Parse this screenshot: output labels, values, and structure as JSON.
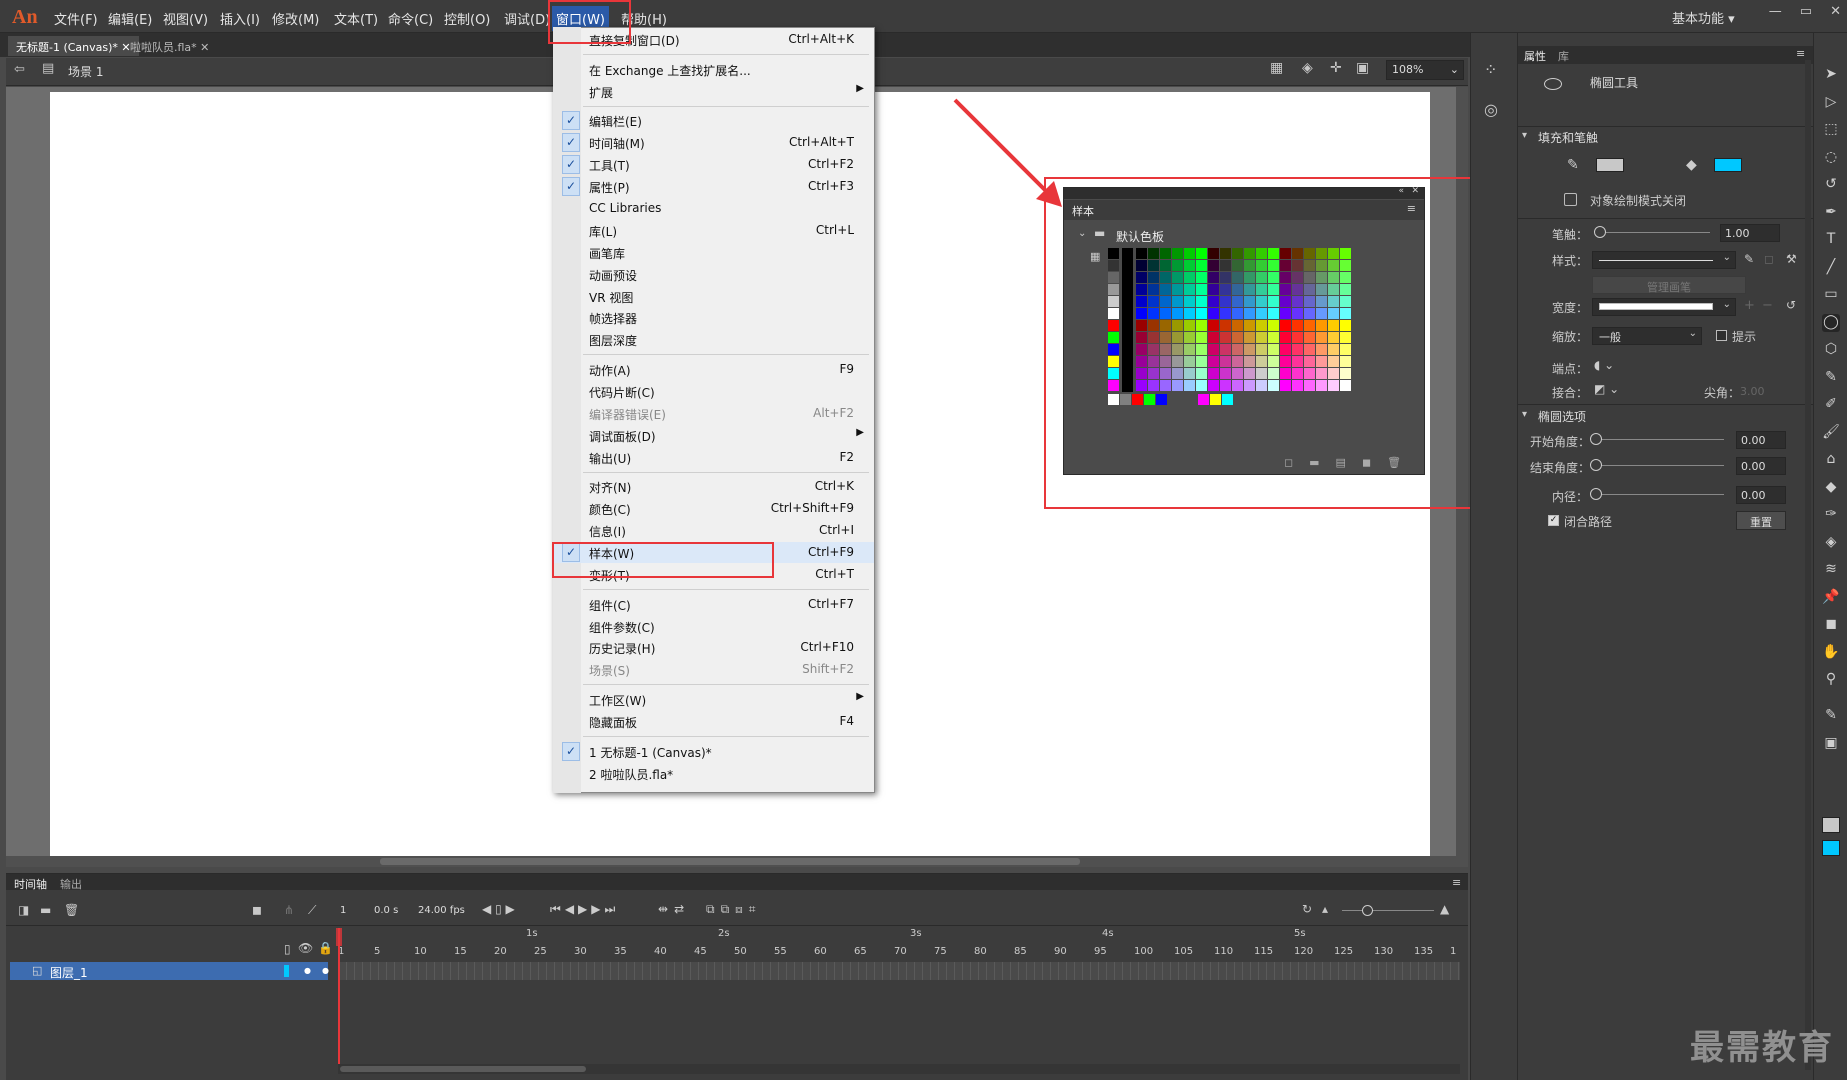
{
  "app": {
    "logo": "An",
    "workspace": "基本功能 ▾",
    "win_controls": [
      "—",
      "▭",
      "✕"
    ]
  },
  "menubar": [
    {
      "label": "文件(F)"
    },
    {
      "label": "编辑(E)"
    },
    {
      "label": "视图(V)"
    },
    {
      "label": "插入(I)"
    },
    {
      "label": "修改(M)"
    },
    {
      "label": "文本(T)"
    },
    {
      "label": "命令(C)"
    },
    {
      "label": "控制(O)"
    },
    {
      "label": "调试(D)"
    },
    {
      "label": "窗口(W)"
    },
    {
      "label": "帮助(H)"
    }
  ],
  "doc_tabs": [
    {
      "label": "无标题-1 (Canvas)*"
    },
    {
      "label": "啦啦队员.fla*"
    }
  ],
  "scene": {
    "label": "场景 1",
    "zoom": "108%"
  },
  "window_menu": [
    {
      "label": "直接复制窗口(D)",
      "sc": "Ctrl+Alt+K"
    },
    {
      "sep": true
    },
    {
      "label": "在 Exchange 上查找扩展名..."
    },
    {
      "label": "扩展",
      "sub": true
    },
    {
      "sep": true
    },
    {
      "label": "编辑栏(E)",
      "check": true
    },
    {
      "label": "时间轴(M)",
      "sc": "Ctrl+Alt+T",
      "check": true
    },
    {
      "label": "工具(T)",
      "sc": "Ctrl+F2",
      "check": true
    },
    {
      "label": "属性(P)",
      "sc": "Ctrl+F3",
      "check": true
    },
    {
      "label": "CC Libraries"
    },
    {
      "label": "库(L)",
      "sc": "Ctrl+L"
    },
    {
      "label": "画笔库"
    },
    {
      "label": "动画预设"
    },
    {
      "label": "VR 视图"
    },
    {
      "label": "帧选择器"
    },
    {
      "label": "图层深度"
    },
    {
      "sep": true
    },
    {
      "label": "动作(A)",
      "sc": "F9"
    },
    {
      "label": "代码片断(C)"
    },
    {
      "label": "编译器错误(E)",
      "sc": "Alt+F2",
      "dis": true
    },
    {
      "label": "调试面板(D)",
      "sub": true
    },
    {
      "label": "输出(U)",
      "sc": "F2"
    },
    {
      "sep": true
    },
    {
      "label": "对齐(N)",
      "sc": "Ctrl+K"
    },
    {
      "label": "颜色(C)",
      "sc": "Ctrl+Shift+F9"
    },
    {
      "label": "信息(I)",
      "sc": "Ctrl+I"
    },
    {
      "label": "样本(W)",
      "sc": "Ctrl+F9",
      "check": true,
      "hl": true
    },
    {
      "label": "变形(T)",
      "sc": "Ctrl+T"
    },
    {
      "sep": true
    },
    {
      "label": "组件(C)",
      "sc": "Ctrl+F7"
    },
    {
      "label": "组件参数(C)"
    },
    {
      "label": "历史记录(H)",
      "sc": "Ctrl+F10"
    },
    {
      "label": "场景(S)",
      "sc": "Shift+F2",
      "dis": true
    },
    {
      "sep": true
    },
    {
      "label": "工作区(W)",
      "sub": true
    },
    {
      "label": "隐藏面板",
      "sc": "F4"
    },
    {
      "sep": true
    },
    {
      "label": "1 无标题-1 (Canvas)*",
      "check": true
    },
    {
      "label": "2 啦啦队员.fla*"
    }
  ],
  "swatch_panel": {
    "tab": "样本",
    "group": "默认色板"
  },
  "properties": {
    "tabs": [
      "属性",
      "库"
    ],
    "tool_name": "椭圆工具",
    "section_fill": "填充和笔触",
    "fill_color": "#00c8ff",
    "stroke_color": "#c8c8c8",
    "object_draw": "对象绘制模式关闭",
    "stroke_label": "笔触：",
    "stroke_value": "1.00",
    "style_label": "样式：",
    "manage_brush": "管理画笔",
    "width_label": "宽度：",
    "scale_label": "缩放：",
    "scale_value": "一般",
    "hint_label": "提示",
    "cap_label": "端点：",
    "join_label": "接合：",
    "miter_label": "尖角：",
    "miter_value": "3.00",
    "section_oval": "椭圆选项",
    "start_angle_label": "开始角度：",
    "start_angle_value": "0.00",
    "end_angle_label": "结束角度：",
    "end_angle_value": "0.00",
    "inner_radius_label": "内径：",
    "inner_radius_value": "0.00",
    "close_path_label": "闭合路径",
    "reset_label": "重置"
  },
  "timeline": {
    "tabs": [
      "时间轴",
      "输出"
    ],
    "frame": "1",
    "time": "0.0 s",
    "fps": "24.00 fps",
    "seconds": [
      "1s",
      "2s",
      "3s",
      "4s",
      "5s"
    ],
    "ticks": [
      "1",
      "5",
      "10",
      "15",
      "20",
      "25",
      "30",
      "35",
      "40",
      "45",
      "50",
      "55",
      "60",
      "65",
      "70",
      "75",
      "80",
      "85",
      "90",
      "95",
      "100",
      "105",
      "110",
      "115",
      "120",
      "125",
      "130",
      "135",
      "1"
    ],
    "layer": "图层_1"
  },
  "watermark": "最需教育",
  "colors": {
    "menu_highlight": "#e8363a",
    "layer_selected": "#3d6cb0"
  }
}
